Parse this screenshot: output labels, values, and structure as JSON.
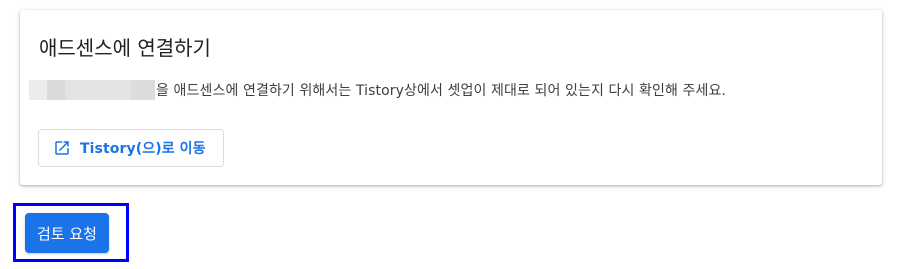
{
  "card": {
    "title": "애드센스에 연결하기",
    "body_text": "을 애드센스에 연결하기 위해서는 Tistory상에서 셋업이 제대로 되어 있는지 다시 확인해 주세요.",
    "link_button_label": "Tistory(으)로 이동",
    "link_button_icon": "open-in-new-icon"
  },
  "actions": {
    "review_button_label": "검토 요청"
  },
  "colors": {
    "accent": "#1a73e8",
    "highlight_frame": "#0000ff",
    "title_text": "#202124",
    "body_text": "#3c4043",
    "button_border": "#dadce0"
  }
}
